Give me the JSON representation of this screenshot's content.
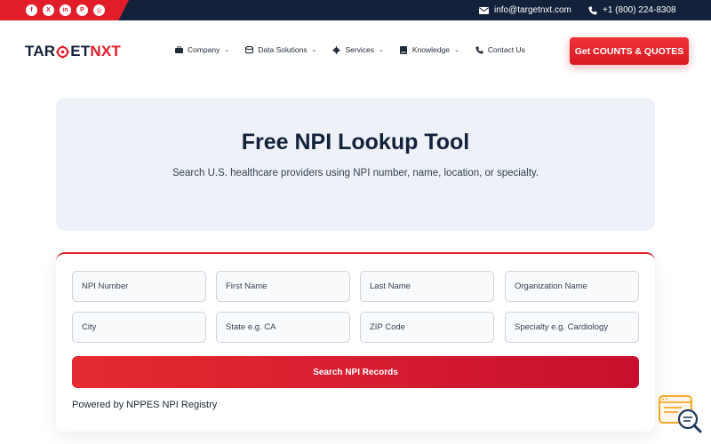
{
  "topbar": {
    "social": [
      {
        "icon": "facebook-icon",
        "glyph": "f"
      },
      {
        "icon": "x-icon",
        "glyph": "X"
      },
      {
        "icon": "linkedin-icon",
        "glyph": "in"
      },
      {
        "icon": "pinterest-icon",
        "glyph": "P"
      },
      {
        "icon": "instagram-icon",
        "glyph": "◎"
      }
    ],
    "email": "info@targetnxt.com",
    "phone": "+1 (800) 224-8308"
  },
  "header": {
    "logo_part1": "TAR",
    "logo_part2": "ET",
    "logo_part3": "NXT",
    "nav": [
      {
        "label": "Company",
        "icon": "briefcase-icon"
      },
      {
        "label": "Data Solutions",
        "icon": "database-icon"
      },
      {
        "label": "Services",
        "icon": "gear-icon"
      },
      {
        "label": "Knowledge",
        "icon": "book-icon"
      },
      {
        "label": "Contact Us",
        "icon": "phone-icon"
      }
    ],
    "cta_label": "Get COUNTS & QUOTES"
  },
  "hero": {
    "title": "Free NPI Lookup Tool",
    "subtitle": "Search U.S. healthcare providers using NPI number, name, location, or specialty."
  },
  "form": {
    "fields": [
      {
        "placeholder": "NPI Number"
      },
      {
        "placeholder": "First Name"
      },
      {
        "placeholder": "Last Name"
      },
      {
        "placeholder": "Organization Name"
      },
      {
        "placeholder": "City"
      },
      {
        "placeholder": "State e.g. CA"
      },
      {
        "placeholder": "ZIP Code"
      },
      {
        "placeholder": "Specialty e.g. Cardiology"
      }
    ],
    "submit_label": "Search NPI Records",
    "powered_by": "Powered by NPPES NPI Registry"
  },
  "colors": {
    "accent": "#e11d2a",
    "navy": "#13213b",
    "hero_bg": "#eef2f8"
  }
}
